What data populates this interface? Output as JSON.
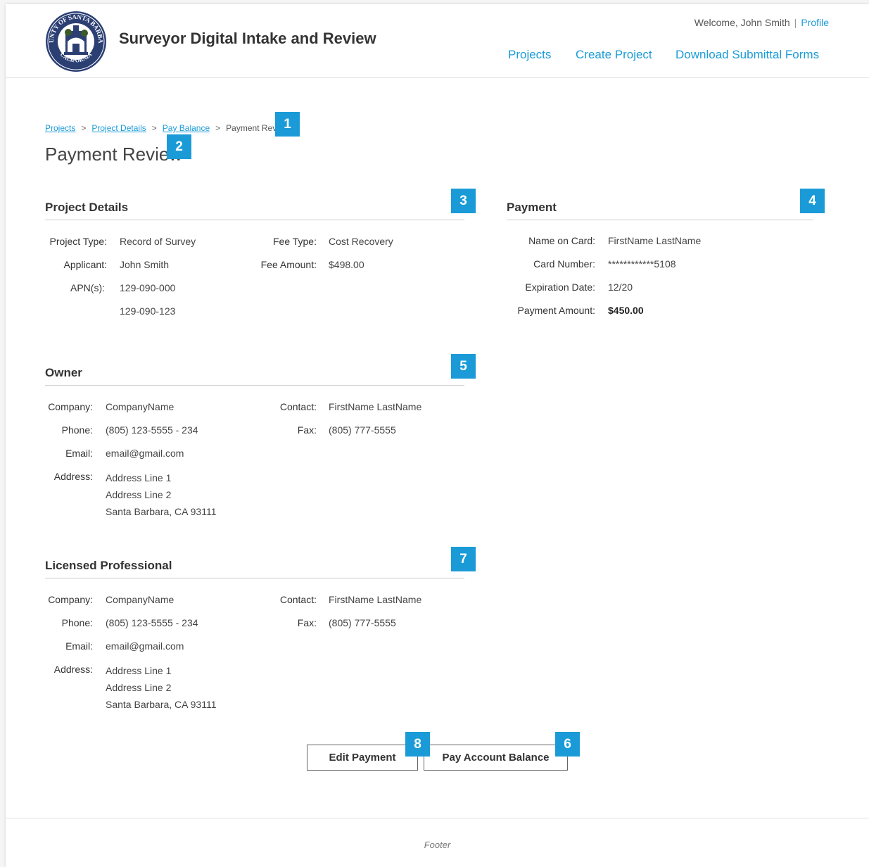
{
  "header": {
    "app_title": "Surveyor Digital Intake and Review",
    "welcome": "Welcome, John Smith",
    "profile": "Profile",
    "nav": [
      "Projects",
      "Create Project",
      "Download Submittal Forms"
    ],
    "logo_text_top": "COUNTY OF SANTA BARBARA",
    "logo_text_bottom": "CALIFORNIA"
  },
  "breadcrumb": {
    "items": [
      "Projects",
      "Project Details",
      "Pay Balance"
    ],
    "current": "Payment Rev",
    "separator": ">"
  },
  "page_title": "Payment Review",
  "markers": [
    "1",
    "2",
    "3",
    "4",
    "5",
    "6",
    "7",
    "8"
  ],
  "project_details": {
    "title": "Project Details",
    "project_type_label": "Project Type:",
    "project_type": "Record of Survey",
    "applicant_label": "Applicant:",
    "applicant": "John Smith",
    "apn_label": "APN(s):",
    "apns": [
      "129-090-000",
      "129-090-123"
    ],
    "fee_type_label": "Fee Type:",
    "fee_type": "Cost Recovery",
    "fee_amount_label": "Fee Amount:",
    "fee_amount": "$498.00"
  },
  "payment": {
    "title": "Payment",
    "name_label": "Name on Card:",
    "name": "FirstName LastName",
    "card_label": "Card Number:",
    "card": "************5108",
    "exp_label": "Expiration Date:",
    "exp": "12/20",
    "amount_label": "Payment Amount:",
    "amount": "$450.00"
  },
  "owner": {
    "title": "Owner",
    "company_label": "Company:",
    "company": "CompanyName",
    "phone_label": "Phone:",
    "phone": "(805) 123-5555 - 234",
    "email_label": "Email:",
    "email": "email@gmail.com",
    "address_label": "Address:",
    "address": [
      "Address Line 1",
      "Address Line 2",
      "Santa Barbara, CA 93111"
    ],
    "contact_label": "Contact:",
    "contact": "FirstName LastName",
    "fax_label": "Fax:",
    "fax": "(805) 777-5555"
  },
  "licensed_professional": {
    "title": "Licensed Professional",
    "company_label": "Company:",
    "company": "CompanyName",
    "phone_label": "Phone:",
    "phone": "(805) 123-5555 - 234",
    "email_label": "Email:",
    "email": "email@gmail.com",
    "address_label": "Address:",
    "address": [
      "Address Line 1",
      "Address Line 2",
      "Santa Barbara, CA 93111"
    ],
    "contact_label": "Contact:",
    "contact": "FirstName LastName",
    "fax_label": "Fax:",
    "fax": "(805) 777-5555"
  },
  "buttons": {
    "edit_payment": "Edit Payment",
    "pay_balance": "Pay Account Balance"
  },
  "footer": "Footer",
  "colors": {
    "accent": "#1a9bd7",
    "text": "#333333",
    "rule": "#cccccc"
  }
}
